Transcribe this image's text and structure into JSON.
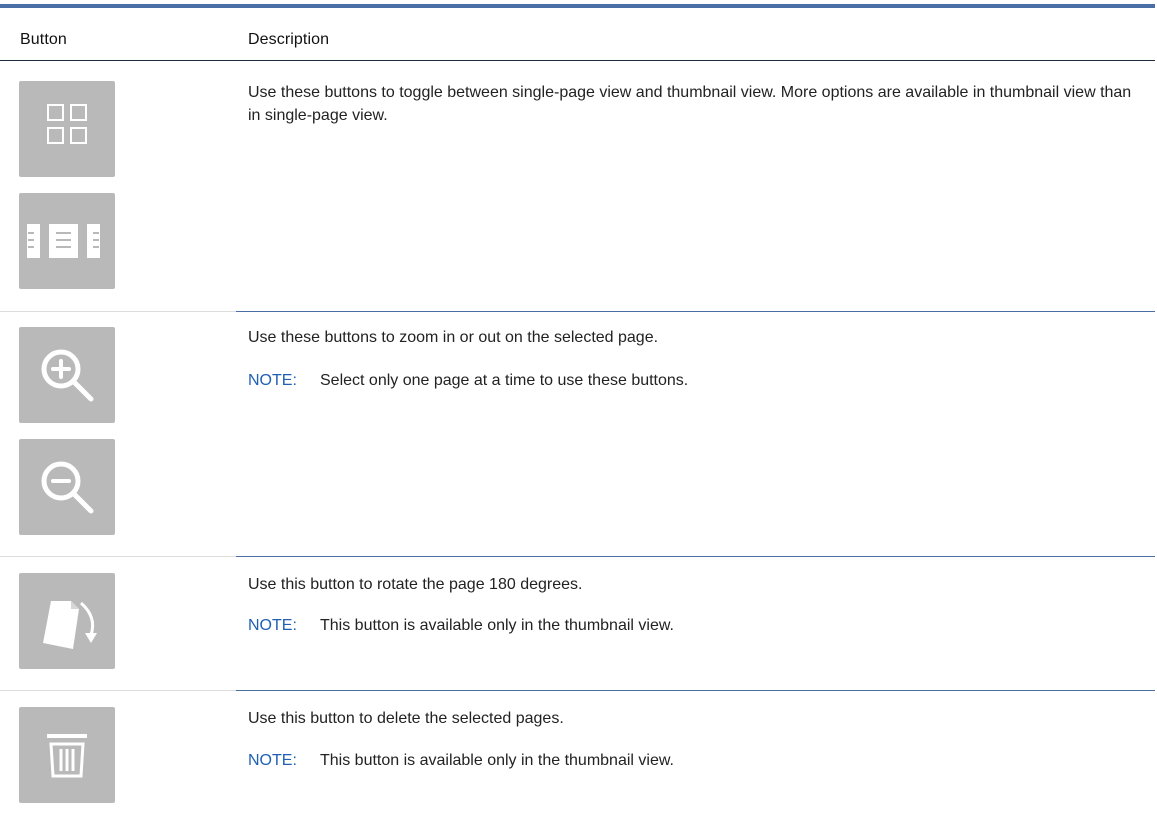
{
  "header": {
    "col_button": "Button",
    "col_description": "Description"
  },
  "rows": [
    {
      "description": "Use these buttons to toggle between single-page view and thumbnail view. More options are available in thumbnail view than in single-page view.",
      "buttons": [
        "thumbnail-view-icon",
        "single-page-view-icon"
      ]
    },
    {
      "description": "Use these buttons to zoom in or out on the selected page.",
      "note_label": "NOTE:",
      "note": "Select only one page at a time to use these buttons.",
      "buttons": [
        "zoom-in-icon",
        "zoom-out-icon"
      ]
    },
    {
      "description": "Use this button to rotate the page 180 degrees.",
      "note_label": "NOTE:",
      "note": "This button is available only in the thumbnail view.",
      "buttons": [
        "rotate-icon"
      ]
    },
    {
      "description": "Use this button to delete the selected pages.",
      "note_label": "NOTE:",
      "note": "This button is available only in the thumbnail view.",
      "buttons": [
        "trash-icon"
      ]
    }
  ],
  "colors": {
    "button_bg": "#b9b9b9",
    "icon": "#ffffff",
    "note": "#1f5fb4",
    "rule": "#4a6ea6"
  }
}
